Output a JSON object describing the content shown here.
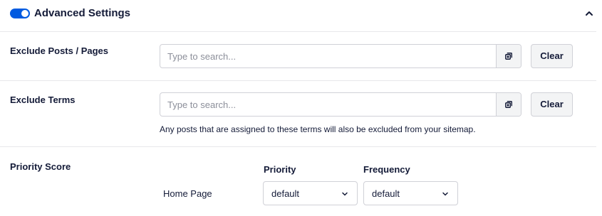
{
  "section": {
    "title": "Advanced Settings",
    "toggle_on": true,
    "accent_color": "#005ae0"
  },
  "exclude_posts": {
    "label": "Exclude Posts / Pages",
    "placeholder": "Type to search...",
    "addon_icon": "copy-icon",
    "clear_label": "Clear"
  },
  "exclude_terms": {
    "label": "Exclude Terms",
    "placeholder": "Type to search...",
    "addon_icon": "copy-icon",
    "clear_label": "Clear",
    "help_text": "Any posts that are assigned to these terms will also be excluded from your sitemap."
  },
  "priority_score": {
    "label": "Priority Score",
    "columns": [
      "Priority",
      "Frequency"
    ],
    "rows": [
      {
        "label": "Home Page",
        "priority": "default",
        "frequency": "default"
      }
    ]
  }
}
